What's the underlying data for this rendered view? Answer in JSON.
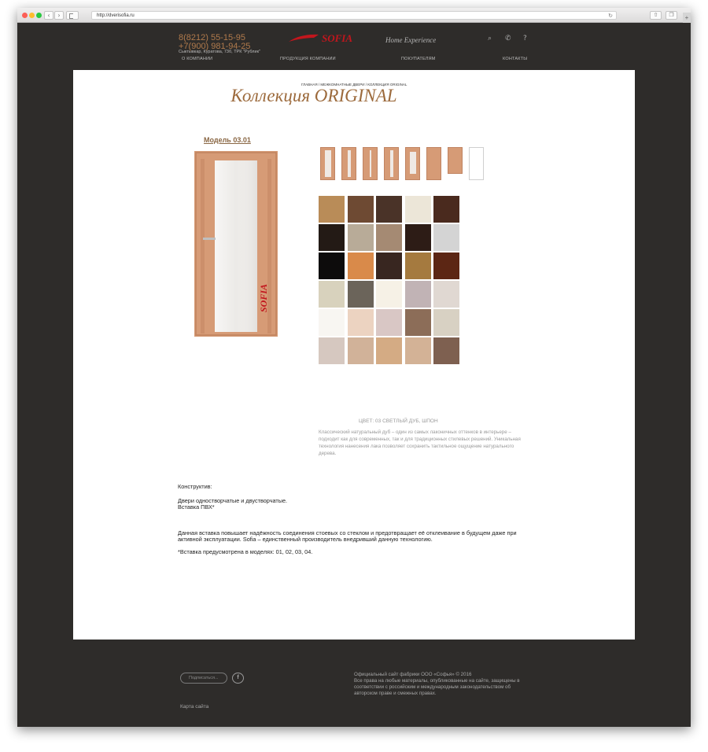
{
  "browser": {
    "url": "http://dverisofia.ru",
    "back_icon": "chevron-left-icon",
    "forward_icon": "chevron-right-icon"
  },
  "header": {
    "phone1": "8(8212) 55-15-95",
    "phone2": "+7(900) 981-94-25",
    "address": "Сыктывкар, Куратова, 73б, ТРК \"Рублик\"",
    "logo_text": "SOFIA",
    "tagline": "Home Experience",
    "nav": [
      "О КОМПАНИИ",
      "ПРОДУКЦИЯ КОМПАНИИ",
      "ПОКУПАТЕЛЯМ",
      "КОНТАКТЫ"
    ],
    "help_label": "?"
  },
  "main": {
    "breadcrumb": "ГЛАВНАЯ / МЕЖКОМНАТНЫЕ ДВЕРИ / КОЛЛЕКЦИЯ ORIGINAL",
    "title": "Коллекция ORIGINAL",
    "model": "Модель 03.01",
    "color_title": "ЦВЕТ: 03 СВЕТЛЫЙ ДУБ, ШПОН",
    "color_description": "Классический натуральный дуб – один из самых лаконичных оттенков в интерьере – подходит как для современных, так и для традиционных стилевых решений. Уникальная технология нанесения лака позволяет сохранить тактильное ощущение натурального дерева.",
    "construct_label": "Конструктив:",
    "construct_line1": "Двери одностворчатые и двустворчатые.",
    "construct_line2": "Вставка ПВХ*",
    "insert_note": "Данная вставка повышает надёжность соединения стоевых со стеклом и предотвращает её отклеивание в будущем даже при активной эксплуатации. Sofia – единственный производитель внедривший данную технологию.",
    "insert_models": "*Вставка предусмотрена в моделях: 01, 02, 03, 04."
  },
  "door_colors": {
    "accent": "#9c6a3c",
    "veneer": "#d69b76",
    "swatches": [
      "#b98c58",
      "#6e4a33",
      "#4a3328",
      "#ece6d8",
      "#4a2a1e",
      "#231a15",
      "#b8ab98",
      "#a58a73",
      "#2d1c16",
      "#d4d4d4",
      "#0d0c0c",
      "#d98a4a",
      "#382620",
      "#a57a3f",
      "#5c2614",
      "#d8d2bd",
      "#6b645a",
      "#f6f1e6",
      "#c1b3b5",
      "#e0d8d2",
      "#f8f6f2",
      "#ecd3c1",
      "#d9c7c5",
      "#8c6d58",
      "#d8d1c3",
      "#d6c8c0",
      "#d1b299",
      "#d4ab84",
      "#d3b296",
      "#7e6050"
    ]
  },
  "footer": {
    "subscribe_placeholder": "Подписаться...",
    "fb_label": "f",
    "copyright_line1": "Официальный сайт фабрики ООО «Софья» © 2016",
    "copyright_line2": "Все права на любые материалы, опубликованные на сайте, защищены в соответствии с российским и международным законодательством об авторском праве и смежных правах.",
    "sitemap": "Карта сайта"
  }
}
